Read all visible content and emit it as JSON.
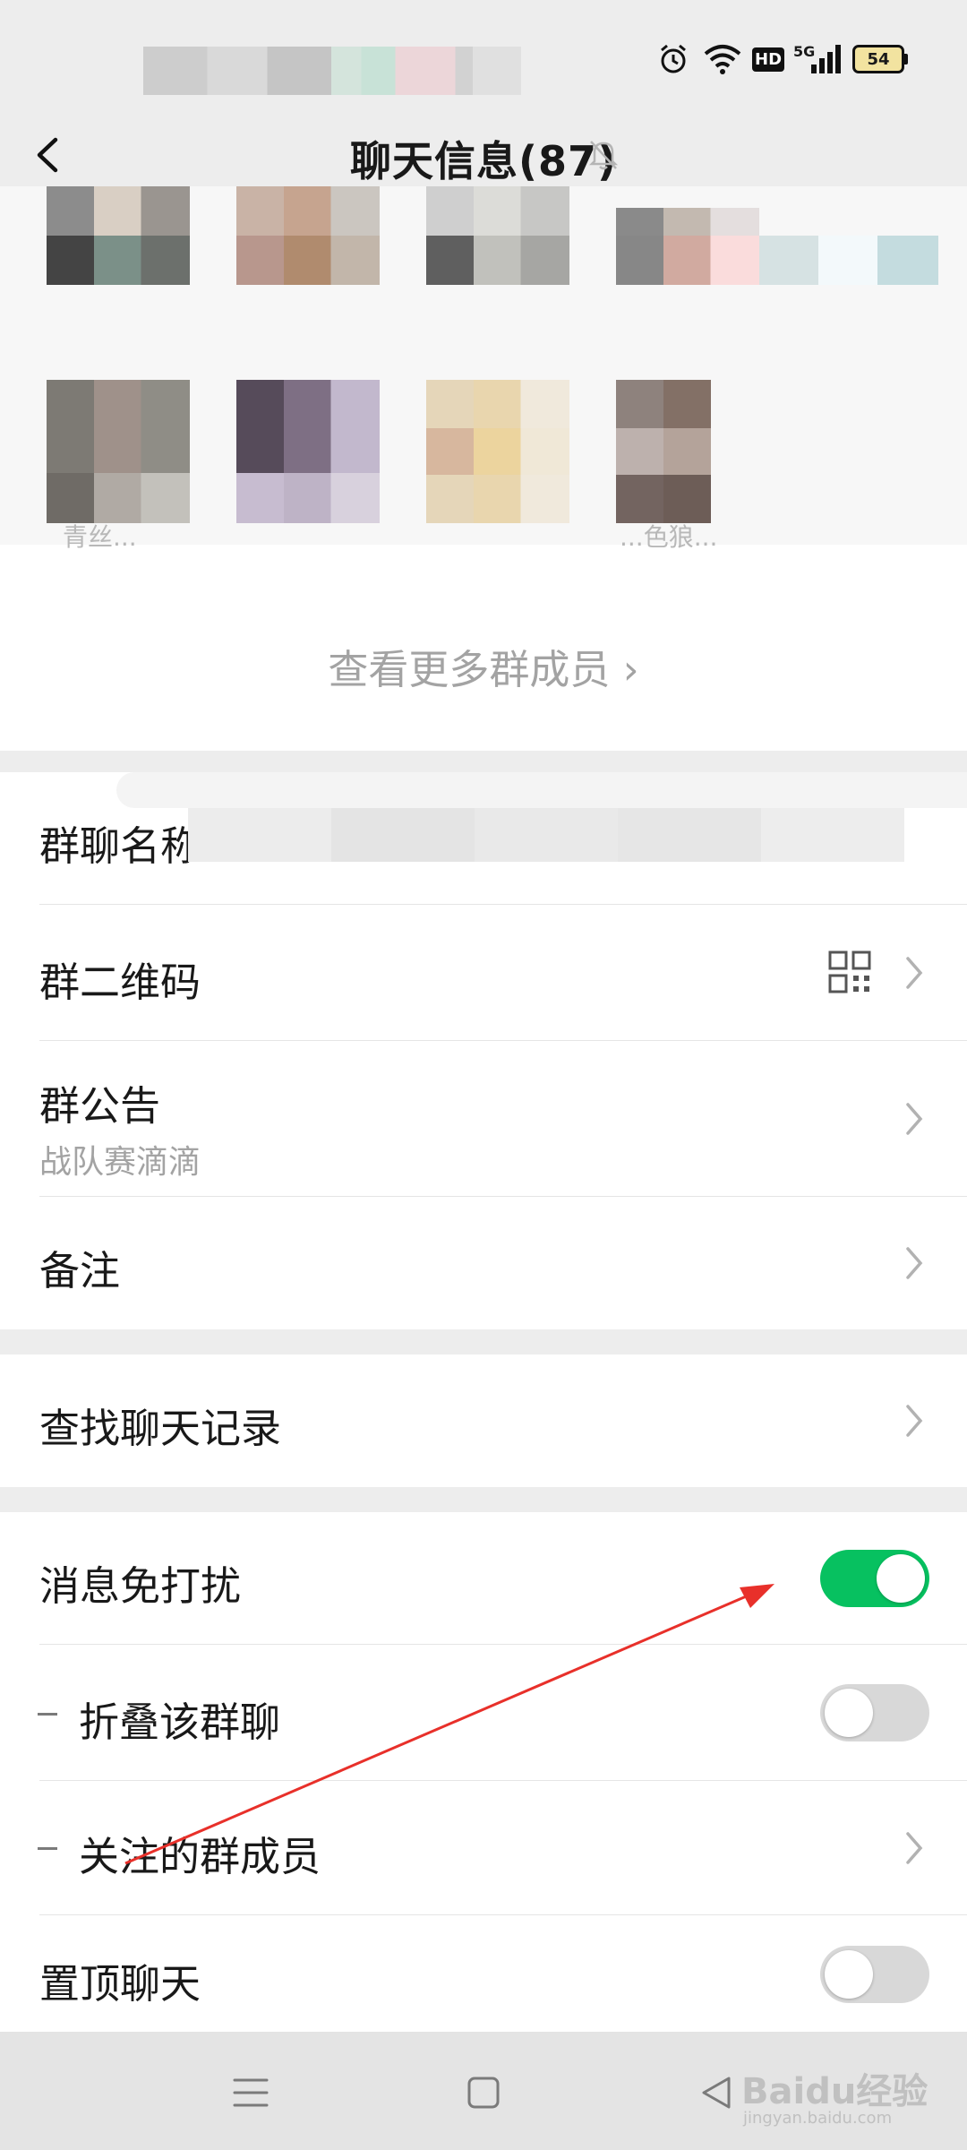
{
  "status_bar": {
    "battery": "54",
    "network": "5G",
    "hd": "HD"
  },
  "nav": {
    "title": "聊天信息(87)"
  },
  "members": {
    "visible_names": [
      "青丝...",
      "...色狼..."
    ],
    "more_label": "查看更多群成员 ›"
  },
  "settings": {
    "group_name_label": "群聊名称",
    "qr_label": "群二维码",
    "notice_label": "群公告",
    "notice_value": "战队赛滴滴",
    "remark_label": "备注",
    "search_label": "查找聊天记录",
    "mute_label": "消息免打扰",
    "mute_on": true,
    "fold_label": "折叠该群聊",
    "fold_on": false,
    "follow_label": "关注的群成员",
    "pin_label": "置顶聊天",
    "pin_on": false
  },
  "colors": {
    "accent": "#07c160",
    "annotation_arrow": "#e8302a"
  },
  "watermark": {
    "brand": "Baidu经验",
    "url": "jingyan.baidu.com"
  }
}
